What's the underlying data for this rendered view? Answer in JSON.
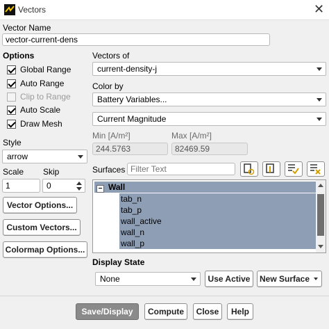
{
  "window": {
    "title": "Vectors",
    "close_glyph": "✕"
  },
  "vector_name": {
    "label": "Vector Name",
    "value": "vector-current-dens"
  },
  "options": {
    "label": "Options",
    "global_range": {
      "label": "Global Range",
      "checked": true
    },
    "auto_range": {
      "label": "Auto Range",
      "checked": true
    },
    "clip_to_range": {
      "label": "Clip to Range",
      "checked": false,
      "enabled": false
    },
    "auto_scale": {
      "label": "Auto Scale",
      "checked": true
    },
    "draw_mesh": {
      "label": "Draw Mesh",
      "checked": true
    }
  },
  "style": {
    "label": "Style",
    "value": "arrow"
  },
  "scale": {
    "label": "Scale",
    "value": "1"
  },
  "skip": {
    "label": "Skip",
    "value": "0"
  },
  "buttons_left": {
    "vector_options": "Vector Options...",
    "custom_vectors": "Custom Vectors...",
    "colormap_options": "Colormap Options..."
  },
  "vectors_of": {
    "label": "Vectors of",
    "value": "current-density-j"
  },
  "color_by": {
    "label": "Color by",
    "category": "Battery Variables...",
    "quantity": "Current Magnitude"
  },
  "range": {
    "min_label": "Min [A/m²]",
    "min_value": "244.5763",
    "max_label": "Max [A/m²]",
    "max_value": "82469.59"
  },
  "surfaces": {
    "label": "Surfaces",
    "filter_placeholder": "Filter Text",
    "tool_icons": [
      "new-surface-icon",
      "select-all-icon",
      "select-none-icon",
      "clear-icon"
    ],
    "group": {
      "expander": "−",
      "name": "Wall"
    },
    "items": [
      "tab_n",
      "tab_p",
      "wall_active",
      "wall_n",
      "wall_p"
    ]
  },
  "display_state": {
    "label": "Display State",
    "value": "None",
    "use_active": "Use Active",
    "new_surface": "New Surface"
  },
  "footer": {
    "save_display": "Save/Display",
    "compute": "Compute",
    "close": "Close",
    "help": "Help"
  },
  "colors": {
    "selection": "#8e9fb5",
    "primary_button": "#8a8a8a"
  }
}
